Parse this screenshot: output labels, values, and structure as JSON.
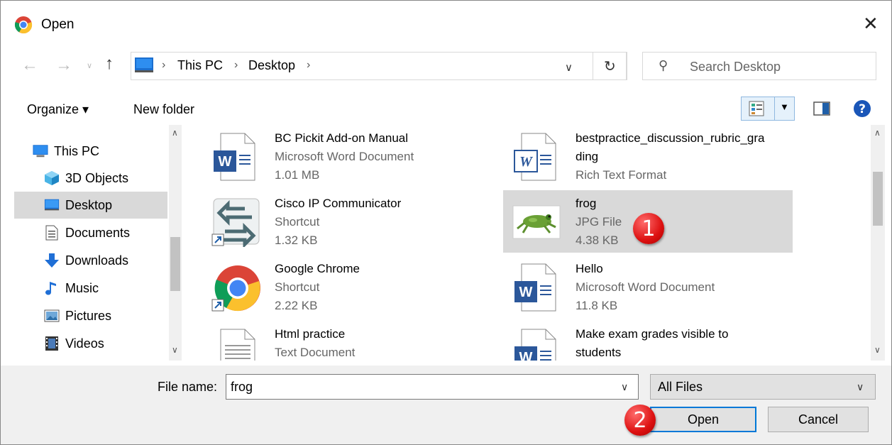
{
  "dialog": {
    "title": "Open"
  },
  "nav": {
    "path": [
      "This PC",
      "Desktop"
    ],
    "search_placeholder": "Search Desktop"
  },
  "toolbar": {
    "organize": "Organize ▾",
    "new_folder": "New folder"
  },
  "sidebar": {
    "items": [
      {
        "label": "This PC",
        "icon": "pc-icon"
      },
      {
        "label": "3D Objects",
        "icon": "cube-icon"
      },
      {
        "label": "Desktop",
        "icon": "desktop-icon",
        "selected": true
      },
      {
        "label": "Documents",
        "icon": "documents-icon"
      },
      {
        "label": "Downloads",
        "icon": "downloads-icon"
      },
      {
        "label": "Music",
        "icon": "music-icon"
      },
      {
        "label": "Pictures",
        "icon": "pictures-icon"
      },
      {
        "label": "Videos",
        "icon": "videos-icon"
      }
    ]
  },
  "files": [
    {
      "name": "BC Pickit Add-on Manual",
      "type": "Microsoft Word Document",
      "size": "1.01 MB",
      "icon": "word-doc-icon"
    },
    {
      "name": "bestpractice_discussion_rubric_gra",
      "name2": "ding",
      "type": "Rich Text Format",
      "icon": "rtf-doc-icon"
    },
    {
      "name": "Cisco IP Communicator",
      "type": "Shortcut",
      "size": "1.32 KB",
      "icon": "cisco-shortcut-icon"
    },
    {
      "name": "frog",
      "type": "JPG File",
      "size": "4.38 KB",
      "icon": "frog-image-thumbnail",
      "selected": true
    },
    {
      "name": "Google Chrome",
      "type": "Shortcut",
      "size": "2.22 KB",
      "icon": "chrome-shortcut-icon"
    },
    {
      "name": "Hello",
      "type": "Microsoft Word Document",
      "size": "11.8 KB",
      "icon": "word-doc-icon"
    },
    {
      "name": "Html practice",
      "type": "Text Document",
      "icon": "text-doc-icon"
    },
    {
      "name": "Make exam grades visible to",
      "name2": "students",
      "icon": "word-doc-icon"
    }
  ],
  "bottom": {
    "file_name_label": "File name:",
    "file_name_value": "frog",
    "filter": "All Files",
    "open": "Open",
    "cancel": "Cancel"
  },
  "annotations": {
    "step1": "1",
    "step2": "2"
  },
  "colors": {
    "selected_bg": "#d9d9d9",
    "accent": "#0078d7",
    "badge": "#d11a1a"
  }
}
